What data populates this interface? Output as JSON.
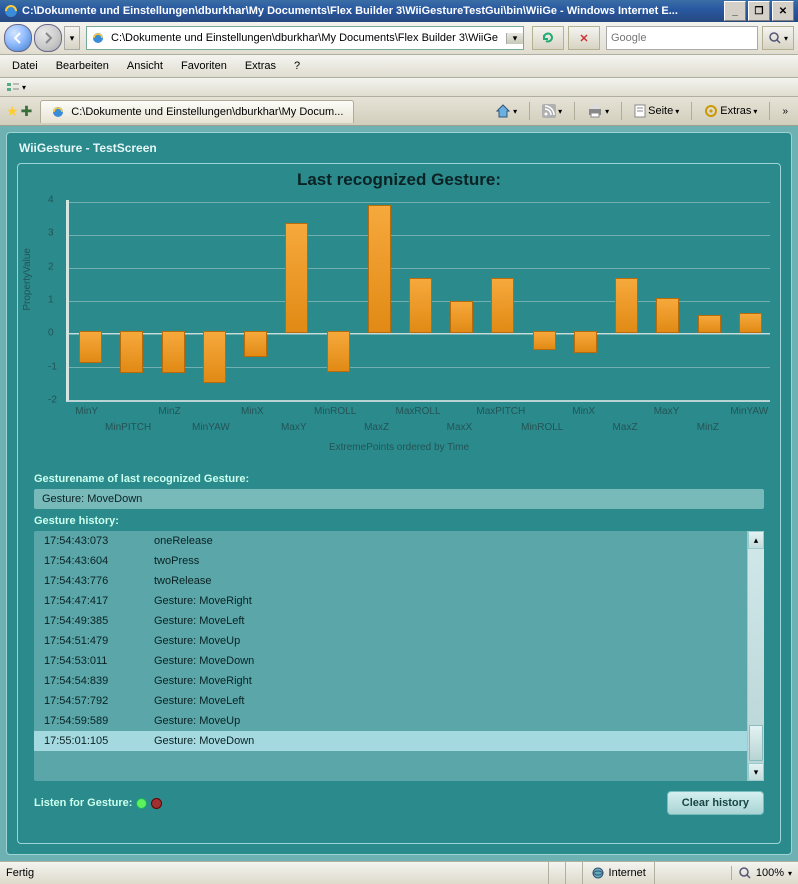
{
  "title": "C:\\Dokumente und Einstellungen\\dburkhar\\My Documents\\Flex Builder 3\\WiiGestureTestGui\\bin\\WiiGe - Windows Internet E...",
  "address": "C:\\Dokumente und Einstellungen\\dburkhar\\My Documents\\Flex Builder 3\\WiiGe",
  "search_placeholder": "Google",
  "menu": {
    "datei": "Datei",
    "bearbeiten": "Bearbeiten",
    "ansicht": "Ansicht",
    "favoriten": "Favoriten",
    "extras": "Extras",
    "help": "?"
  },
  "tab_label": "C:\\Dokumente und Einstellungen\\dburkhar\\My Docum...",
  "tbar": {
    "seite": "Seite",
    "extras": "Extras"
  },
  "panel_title": "WiiGesture - TestScreen",
  "chart_title": "Last recognized Gesture:",
  "ylabel": "PropertyValue",
  "xsub": "ExtremePoints ordered by Time",
  "gesture_label": "Gesturename of last recognized Gesture:",
  "gesture_value": "Gesture: MoveDown",
  "history_label": "Gesture history:",
  "listen_label": "Listen for Gesture:",
  "clear_label": "Clear history",
  "status_left": "Fertig",
  "status_zone": "Internet",
  "status_zoom": "100%",
  "yticks": [
    "4",
    "3",
    "2",
    "1",
    "0",
    "-1",
    "-2"
  ],
  "chart_data": {
    "type": "bar",
    "title": "Last recognized Gesture:",
    "ylabel": "PropertyValue",
    "xlabel": "ExtremePoints ordered by Time",
    "ylim": [
      -2,
      4
    ],
    "categories": [
      "MinY",
      "MinPITCH",
      "MinZ",
      "MinYAW",
      "MinX",
      "MaxY",
      "MinROLL",
      "MaxZ",
      "MaxROLL",
      "MaxX",
      "MaxPITCH",
      "MinROLL",
      "MinX",
      "MaxZ",
      "MaxY",
      "MinZ",
      "MinYAW"
    ],
    "values": [
      -0.9,
      -1.2,
      -1.2,
      -1.5,
      -0.7,
      3.25,
      -1.15,
      3.8,
      1.6,
      0.9,
      1.6,
      -0.5,
      -0.6,
      1.6,
      1.0,
      0.5,
      0.55
    ]
  },
  "history": [
    {
      "t": "17:54:43:073",
      "g": "oneRelease"
    },
    {
      "t": "17:54:43:604",
      "g": "twoPress"
    },
    {
      "t": "17:54:43:776",
      "g": "twoRelease"
    },
    {
      "t": "17:54:47:417",
      "g": "Gesture: MoveRight"
    },
    {
      "t": "17:54:49:385",
      "g": "Gesture: MoveLeft"
    },
    {
      "t": "17:54:51:479",
      "g": "Gesture: MoveUp"
    },
    {
      "t": "17:54:53:011",
      "g": "Gesture: MoveDown"
    },
    {
      "t": "17:54:54:839",
      "g": "Gesture: MoveRight"
    },
    {
      "t": "17:54:57:792",
      "g": "Gesture: MoveLeft"
    },
    {
      "t": "17:54:59:589",
      "g": "Gesture: MoveUp"
    },
    {
      "t": "17:55:01:105",
      "g": "Gesture: MoveDown"
    }
  ]
}
